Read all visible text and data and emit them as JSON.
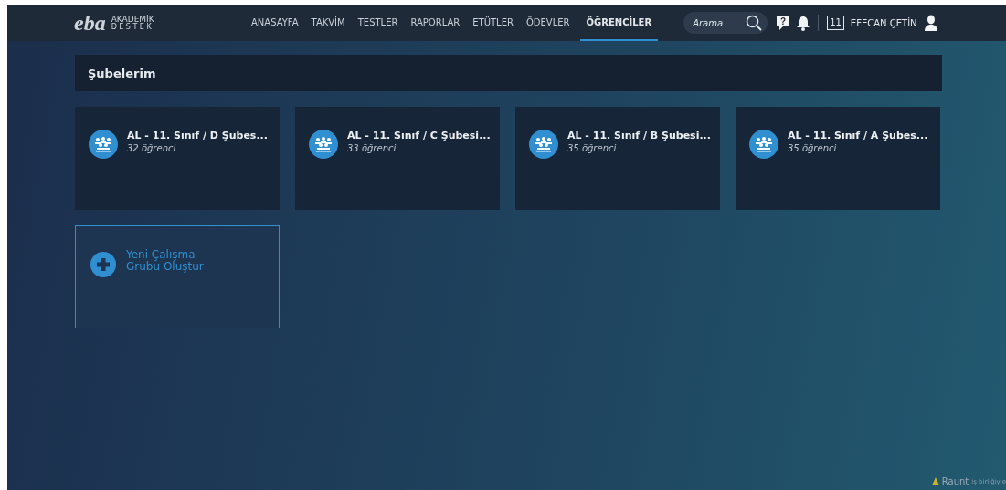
{
  "header": {
    "logo": "eba",
    "logo_line1": "AKADEMİK",
    "logo_line2": "DESTEK",
    "nav": [
      {
        "label": "ANASAYFA",
        "selected": false
      },
      {
        "label": "TAKVİM",
        "selected": false
      },
      {
        "label": "TESTLER",
        "selected": false
      },
      {
        "label": "RAPORLAR",
        "selected": false
      },
      {
        "label": "ETÜTLER",
        "selected": false
      },
      {
        "label": "ÖDEVLER",
        "selected": false
      },
      {
        "label": "ÖĞRENCİLER",
        "selected": true
      }
    ],
    "search": {
      "placeholder": "Arama"
    },
    "help": "?",
    "calendar_day": "11",
    "user": "EFECAN ÇETİN"
  },
  "section_title": "Şubelerim",
  "classes": [
    {
      "name": "AL - 11. Sınıf / D Şubes...",
      "count": "32 öğrenci"
    },
    {
      "name": "AL - 11. Sınıf / C Şubesi...",
      "count": "33 öğrenci"
    },
    {
      "name": "AL - 11. Sınıf / B Şubesi...",
      "count": "35 öğrenci"
    },
    {
      "name": "AL - 11. Sınıf / A Şubes...",
      "count": "35 öğrenci"
    }
  ],
  "new_group": "Yeni Çalışma Grubu Oluştur",
  "footer": {
    "brand": "Raunt",
    "note": "iş birliğiyle"
  }
}
